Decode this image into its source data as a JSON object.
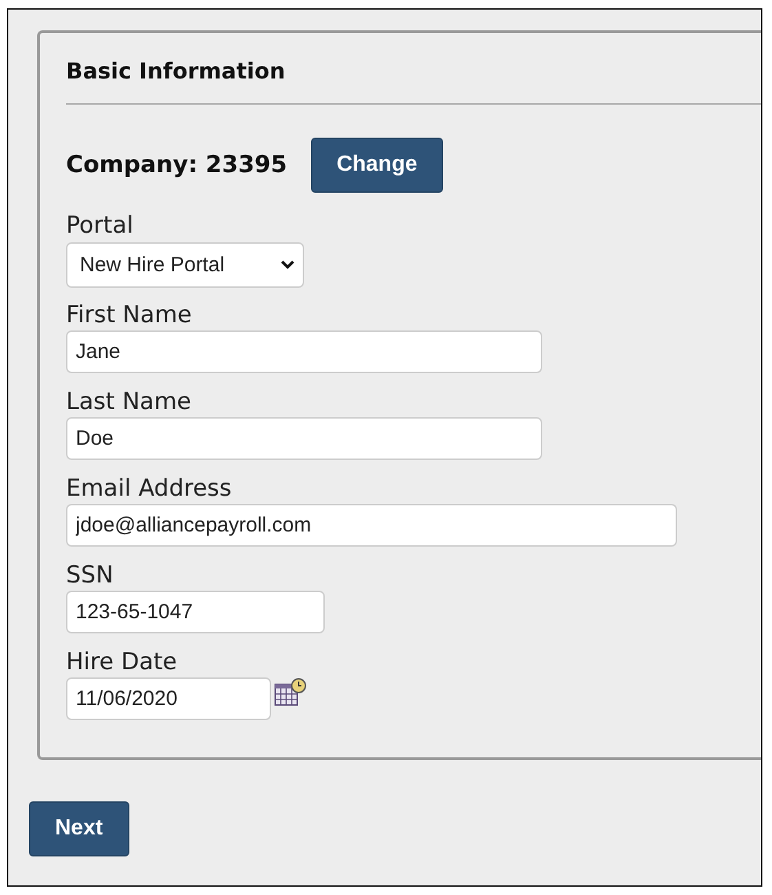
{
  "section": {
    "title": "Basic Information"
  },
  "company": {
    "label": "Company: 23395",
    "button": "Change"
  },
  "fields": [
    {
      "kind": "select",
      "label": "Portal",
      "value": "New Hire Portal"
    },
    {
      "kind": "text",
      "label": "First Name",
      "value": "Jane"
    },
    {
      "kind": "text",
      "label": "Last Name",
      "value": "Doe"
    },
    {
      "kind": "text",
      "label": "Email Address",
      "value": "jdoe@alliancepayroll.com"
    },
    {
      "kind": "text",
      "label": "SSN",
      "value": "123-65-1047"
    },
    {
      "kind": "date",
      "label": "Hire Date",
      "value": "11/06/2020"
    }
  ],
  "buttons": [
    "Next"
  ]
}
